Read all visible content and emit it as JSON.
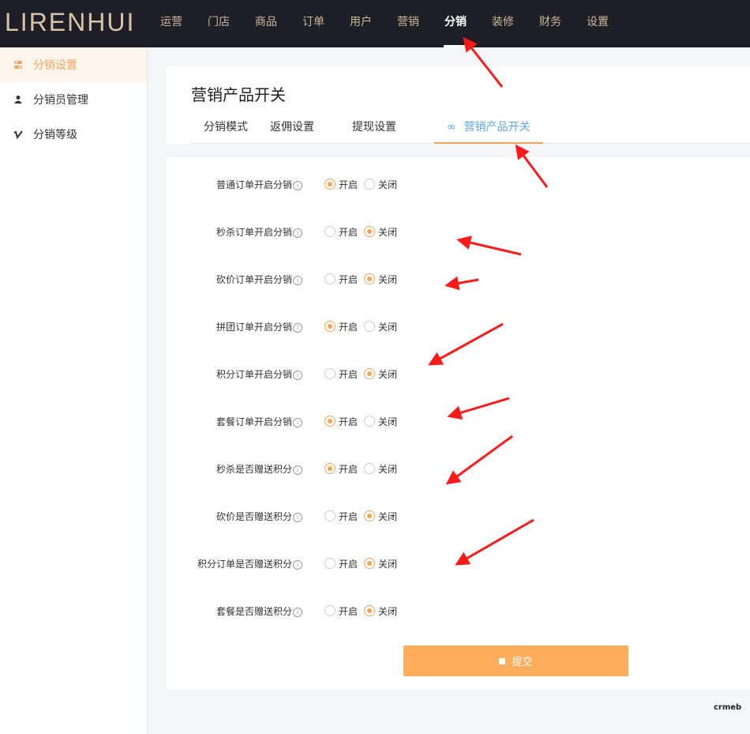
{
  "brand": {
    "logo": "LIRENHUI",
    "mini": "crmeb"
  },
  "nav": {
    "items": [
      "运营",
      "门店",
      "商品",
      "订单",
      "用户",
      "营销",
      "分销",
      "装修",
      "财务",
      "设置"
    ],
    "active": "分销"
  },
  "sidebar": {
    "items": [
      {
        "label": "分销设置",
        "icon": "toggle-icon",
        "active": true
      },
      {
        "label": "分销员管理",
        "icon": "user-icon",
        "active": false
      },
      {
        "label": "分销等级",
        "icon": "vimeo-icon",
        "active": false
      }
    ]
  },
  "page": {
    "title": "营销产品开关",
    "tabs": [
      "分销模式",
      "返佣设置",
      "提现设置",
      "营销产品开关"
    ],
    "active_tab": "营销产品开关"
  },
  "form": {
    "options": {
      "on": "开启",
      "off": "关闭"
    },
    "rows": [
      {
        "label": "普通订单开启分销",
        "value": "on"
      },
      {
        "label": "秒杀订单开启分销",
        "value": "off"
      },
      {
        "label": "砍价订单开启分销",
        "value": "off"
      },
      {
        "label": "拼团订单开启分销",
        "value": "on"
      },
      {
        "label": "积分订单开启分销",
        "value": "off"
      },
      {
        "label": "套餐订单开启分销",
        "value": "on"
      },
      {
        "label": "秒杀是否赠送积分",
        "value": "on"
      },
      {
        "label": "砍价是否赠送积分",
        "value": "off"
      },
      {
        "label": "积分订单是否赠送积分",
        "value": "off"
      },
      {
        "label": "套餐是否赠送积分",
        "value": "off"
      }
    ],
    "submit_label": "提交"
  },
  "colors": {
    "accent": "#f5a55a",
    "tab_active": "#5ba6e8",
    "topbar": "#1e1e26",
    "arrow": "#ff1a1a"
  }
}
